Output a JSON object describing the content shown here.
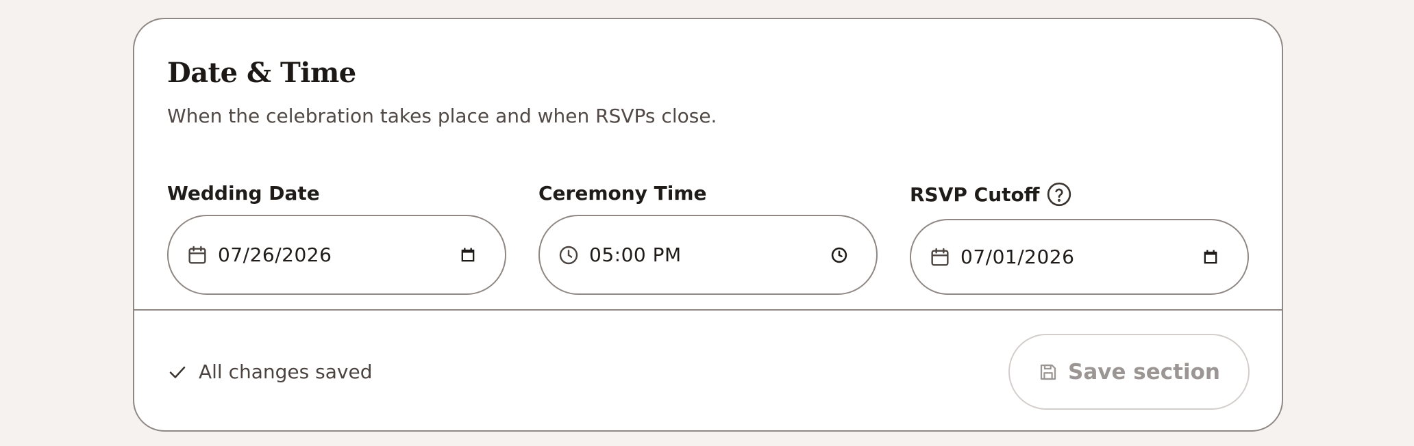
{
  "section": {
    "title": "Date & Time",
    "subtitle": "When the celebration takes place and when RSVPs close."
  },
  "fields": {
    "wedding_date": {
      "label": "Wedding Date",
      "value": "07/26/2026",
      "icon": "calendar-icon"
    },
    "ceremony_time": {
      "label": "Ceremony Time",
      "value": "05:00 PM",
      "icon": "clock-icon"
    },
    "rsvp_cutoff": {
      "label": "RSVP Cutoff",
      "value": "07/01/2026",
      "icon": "calendar-icon",
      "help_icon": "help-circle-icon"
    }
  },
  "footer": {
    "status_text": "All changes saved",
    "save_label": "Save section"
  },
  "colors": {
    "background": "#f6f2ef",
    "card_border": "#8e8783",
    "disabled_text": "#9b9693"
  }
}
